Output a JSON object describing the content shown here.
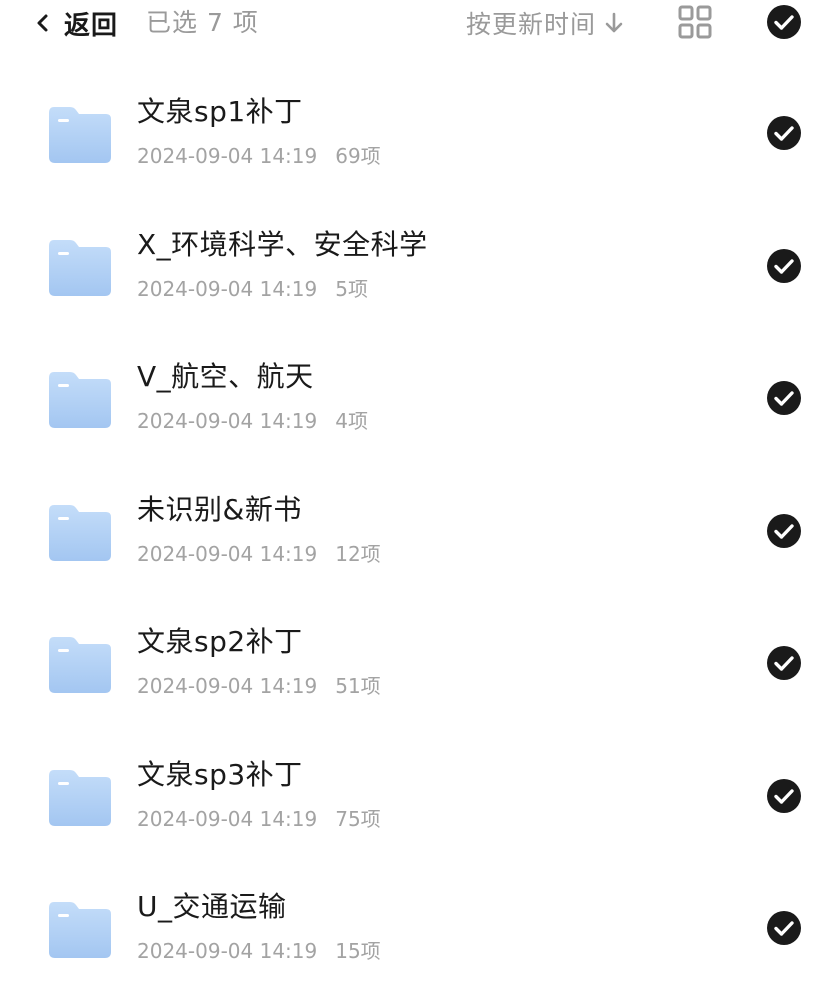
{
  "header": {
    "back_label": "返回",
    "selected_text": "已选 7 项",
    "sort_label": "按更新时间",
    "icons": {
      "back": "chevron-left-icon",
      "sort": "arrow-down-icon",
      "view": "grid-view-icon",
      "select_all": "check-circle-icon"
    }
  },
  "colors": {
    "check_fill": "#1a1a1a",
    "folder_top": "#bcd8f8",
    "folder_bottom": "#a6c9f2"
  },
  "folders": [
    {
      "name": "文泉sp1补丁",
      "date": "2024-09-04 14:19",
      "count": "69项",
      "selected": true
    },
    {
      "name": "X_环境科学、安全科学",
      "date": "2024-09-04 14:19",
      "count": "5项",
      "selected": true
    },
    {
      "name": "V_航空、航天",
      "date": "2024-09-04 14:19",
      "count": "4项",
      "selected": true
    },
    {
      "name": "未识别&新书",
      "date": "2024-09-04 14:19",
      "count": "12项",
      "selected": true
    },
    {
      "name": "文泉sp2补丁",
      "date": "2024-09-04 14:19",
      "count": "51项",
      "selected": true
    },
    {
      "name": "文泉sp3补丁",
      "date": "2024-09-04 14:19",
      "count": "75项",
      "selected": true
    },
    {
      "name": "U_交通运输",
      "date": "2024-09-04 14:19",
      "count": "15项",
      "selected": true
    }
  ]
}
